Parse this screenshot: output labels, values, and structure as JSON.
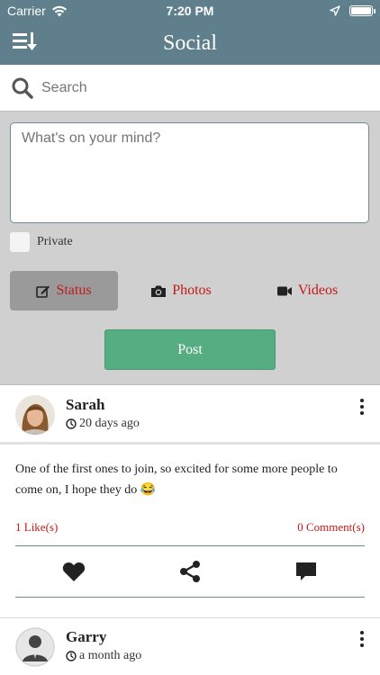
{
  "status_bar": {
    "carrier": "Carrier",
    "time": "7:20 PM"
  },
  "nav": {
    "title": "Social"
  },
  "search": {
    "placeholder": "Search",
    "value": ""
  },
  "composer": {
    "placeholder": "What's on your mind?",
    "private_label": "Private",
    "types": [
      {
        "label": "Status",
        "icon": "edit-icon",
        "active": true
      },
      {
        "label": "Photos",
        "icon": "camera-icon",
        "active": false
      },
      {
        "label": "Videos",
        "icon": "video-icon",
        "active": false
      }
    ],
    "post_label": "Post"
  },
  "posts": [
    {
      "author": "Sarah",
      "time": "20 days ago",
      "text": "One of the first ones to join, so excited for some more people to come on, I hope they do 😂",
      "likes": "1 Like(s)",
      "comments": "0 Comment(s)"
    },
    {
      "author": "Garry",
      "time": "a month ago"
    }
  ],
  "colors": {
    "header": "#5f7f8c",
    "accent_red": "#c31a1a",
    "post_button": "#56ad82",
    "composer_bg": "#d0d0d0"
  }
}
